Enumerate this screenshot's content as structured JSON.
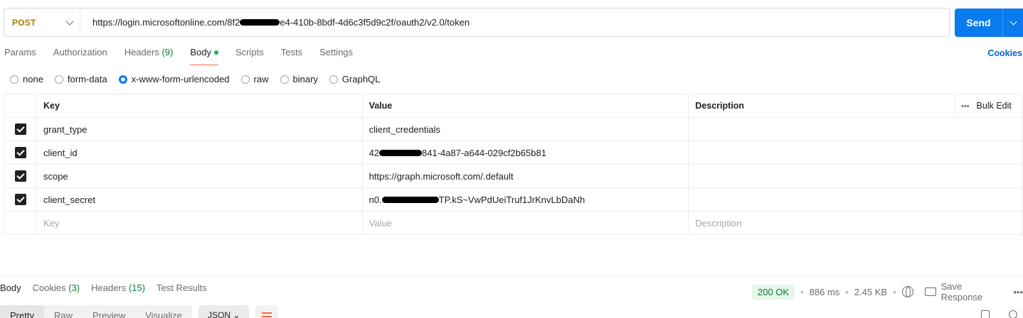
{
  "request": {
    "method": "POST",
    "url_start": "https://login.microsoftonline.com/8f2",
    "url_end": "e4-410b-8bdf-4d6c3f5d9c2f/oauth2/v2.0/token",
    "send_label": "Send"
  },
  "tabs": {
    "params": "Params",
    "authorization": "Authorization",
    "headers": "Headers",
    "headers_count": "(9)",
    "body": "Body",
    "scripts": "Scripts",
    "tests": "Tests",
    "settings": "Settings",
    "cookies": "Cookies"
  },
  "body_types": {
    "none": "none",
    "form_data": "form-data",
    "urlencoded": "x-www-form-urlencoded",
    "raw": "raw",
    "binary": "binary",
    "graphql": "GraphQL",
    "selected": "x-www-form-urlencoded"
  },
  "table": {
    "headers": {
      "key": "Key",
      "value": "Value",
      "description": "Description",
      "bulk_edit": "Bulk Edit"
    },
    "rows": [
      {
        "key": "grant_type",
        "value_start": "client_credentials",
        "value_end": "",
        "checked": true
      },
      {
        "key": "client_id",
        "value_start": "42",
        "value_end": "841-4a87-a644-029cf2b65b81",
        "checked": true
      },
      {
        "key": "scope",
        "value_start": "https://graph.microsoft.com/.default",
        "value_end": "",
        "checked": true
      },
      {
        "key": "client_secret",
        "value_start": "n0.",
        "value_end": "TP.kS~VwPdUeiTruf1JrKnvLbDaNh",
        "checked": true
      }
    ],
    "placeholder": {
      "key": "Key",
      "value": "Value",
      "description": "Description"
    }
  },
  "response": {
    "tabs": {
      "body": "Body",
      "cookies": "Cookies",
      "cookies_count": "(3)",
      "headers": "Headers",
      "headers_count": "(15)",
      "test_results": "Test Results"
    },
    "status": "200 OK",
    "time": "886 ms",
    "size": "2.45 KB",
    "save_response": "Save Response",
    "formats": {
      "pretty": "Pretty",
      "raw": "Raw",
      "preview": "Preview",
      "visualize": "Visualize"
    },
    "language": "JSON"
  },
  "colors": {
    "accent": "#097bed",
    "method": "#ad7a03",
    "active_tab_underline": "#f26b3a",
    "status_ok": "#0a7d3b"
  }
}
